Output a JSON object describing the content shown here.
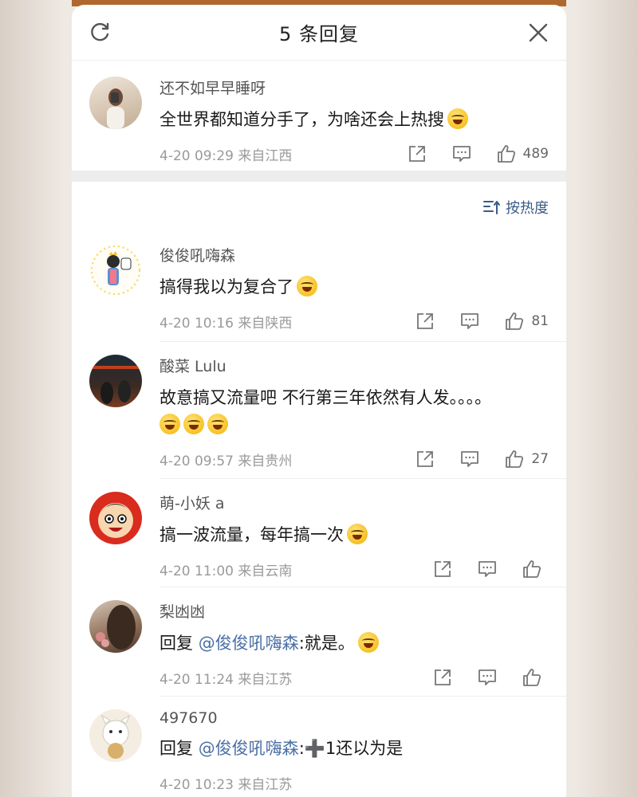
{
  "header": {
    "title": "5 条回复"
  },
  "root_comment": {
    "name": "还不如早早睡呀",
    "text": "全世界都知道分手了，为啥还会上热搜",
    "meta": "4-20 09:29  来自江西",
    "likes": "489"
  },
  "sort": {
    "label": "按热度"
  },
  "replies": [
    {
      "name": "俊俊吼嗨森",
      "text": "搞得我以为复合了",
      "meta": "4-20 10:16  来自陕西",
      "likes": "81"
    },
    {
      "name": "酸菜 Lulu",
      "text": "故意搞又流量吧  不行第三年依然有人发。。。。",
      "meta": "4-20 09:57  来自贵州",
      "likes": "27"
    },
    {
      "name": "萌-小妖 a",
      "text": "搞一波流量，每年搞一次",
      "meta": "4-20 11:00  来自云南",
      "likes": ""
    },
    {
      "name": "梨凼凼",
      "reply_prefix": "回复",
      "reply_at": "@俊俊吼嗨森",
      "text": ":就是。",
      "meta": "4-20 11:24  来自江苏",
      "likes": ""
    },
    {
      "name": "497670",
      "reply_prefix": "回复",
      "reply_at": "@俊俊吼嗨森",
      "text": ":➕1还以为是",
      "meta": "4-20 10:23  来自江苏",
      "likes": ""
    }
  ],
  "icons": [
    "refresh-icon",
    "close-icon",
    "share-icon",
    "comment-icon",
    "like-icon",
    "sort-icon",
    "laugh-cry-emoji",
    "crying-emoji"
  ],
  "colors": {
    "link": "#4a6fa5",
    "accent_bar": "#b0682f"
  }
}
